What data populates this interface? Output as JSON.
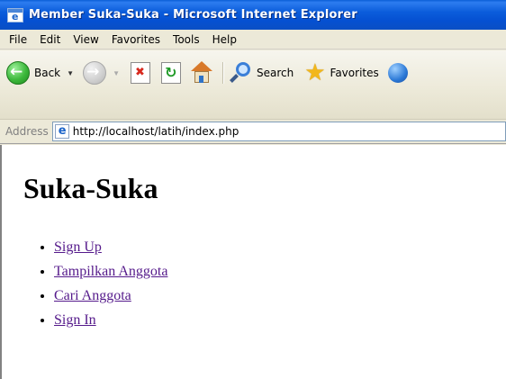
{
  "window": {
    "title": "Member Suka-Suka - Microsoft Internet Explorer"
  },
  "menu": {
    "items": [
      {
        "label": "File"
      },
      {
        "label": "Edit"
      },
      {
        "label": "View"
      },
      {
        "label": "Favorites"
      },
      {
        "label": "Tools"
      },
      {
        "label": "Help"
      }
    ]
  },
  "toolbar": {
    "back_label": "Back",
    "search_label": "Search",
    "favorites_label": "Favorites"
  },
  "address": {
    "label": "Address",
    "url": "http://localhost/latih/index.php"
  },
  "page": {
    "heading": "Suka-Suka",
    "links": [
      {
        "label": "Sign Up"
      },
      {
        "label": "Tampilkan Anggota"
      },
      {
        "label": "Cari Anggota"
      },
      {
        "label": "Sign In"
      }
    ]
  },
  "colors": {
    "titlebar_blue": "#0b5ddb",
    "chrome_bg": "#ece9d8",
    "visited_link": "#551a8b"
  },
  "icons": [
    "ie-icon",
    "back-icon",
    "forward-icon",
    "stop-icon",
    "refresh-icon",
    "home-icon",
    "search-icon",
    "favorites-star-icon",
    "media-icon",
    "page-icon"
  ]
}
